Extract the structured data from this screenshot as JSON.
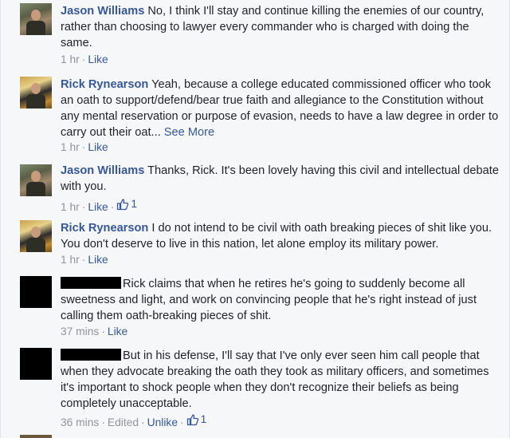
{
  "comments": [
    {
      "author": "Jason Williams",
      "text": " No, I think I'll stay and continue killing the enemies of our country, rather than choosing to lawyer every commander who is charged with doing the same.",
      "time": "1 hr",
      "action": "Like"
    },
    {
      "author": "Rick Rynearson",
      "text": " Yeah, because a college educated commissioned officer who took an oath to support/defend/bear true faith and allegiance to the Constitution without any mental reservation or purpose of evasion, needs to have a law degree in order to carry out their oat...",
      "see_more": "See More",
      "time": "1 hr",
      "action": "Like"
    },
    {
      "author": "Jason Williams",
      "text": " Thanks, Rick. It's been lovely having this civil and intellectual debate with you.",
      "time": "1 hr",
      "action": "Like",
      "like_count": "1"
    },
    {
      "author": "Rick Rynearson",
      "text": " I do not intend to be civil with oath breaking pieces of shit like you. You don't deserve to live in this nation, let alone employ its military power.",
      "time": "1 hr",
      "action": "Like"
    },
    {
      "text": "Rick claims that when he retires he's going to suddenly become all sweetness and light, and work on convincing people that he's right instead of just calling them oath-breaking pieces of shit.",
      "time": "37 mins",
      "action": "Like"
    },
    {
      "text": "But in his defense, I'll say that I've only ever seen him call people that when they advocate breaking the oath they took as military officers, and sometimes it's important to shock people when they don't recognize their beliefs as being completely unacceptable.",
      "time": "36 mins",
      "edited": "Edited",
      "action": "Unlike",
      "like_count": "1"
    }
  ],
  "colors": {
    "link": "#365899",
    "meta": "#90949c",
    "text": "#1d2129",
    "background": "#f6f7f9"
  }
}
